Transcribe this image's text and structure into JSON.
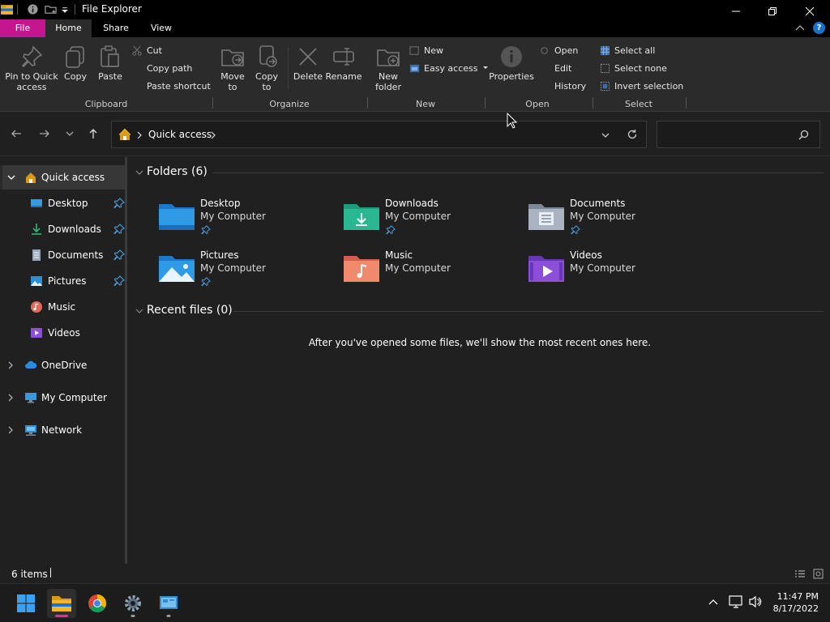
{
  "window": {
    "title": "File Explorer"
  },
  "ribbon_tabs": {
    "file": "File",
    "home": "Home",
    "share": "Share",
    "view": "View"
  },
  "ribbon": {
    "pin_quick_access": "Pin to Quick\naccess",
    "copy": "Copy",
    "paste": "Paste",
    "cut": "Cut",
    "copy_path": "Copy path",
    "paste_shortcut": "Paste shortcut",
    "move_to": "Move\nto",
    "copy_to": "Copy\nto",
    "delete": "Delete",
    "rename": "Rename",
    "new_folder": "New\nfolder",
    "new_item": "New",
    "easy_access": "Easy access",
    "properties": "Properties",
    "open": "Open",
    "edit": "Edit",
    "history": "History",
    "select_all": "Select all",
    "select_none": "Select none",
    "invert_selection": "Invert selection",
    "groups": {
      "clipboard": "Clipboard",
      "organize": "Organize",
      "new": "New",
      "open": "Open",
      "select": "Select"
    }
  },
  "address": {
    "location": "Quick access",
    "search_placeholder": ""
  },
  "nav": {
    "quick_access": "Quick access",
    "items": [
      {
        "label": "Desktop",
        "pinned": true
      },
      {
        "label": "Downloads",
        "pinned": true
      },
      {
        "label": "Documents",
        "pinned": true
      },
      {
        "label": "Pictures",
        "pinned": true
      },
      {
        "label": "Music",
        "pinned": false
      },
      {
        "label": "Videos",
        "pinned": false
      }
    ],
    "onedrive": "OneDrive",
    "my_computer": "My Computer",
    "network": "Network"
  },
  "content": {
    "folders_header": "Folders (6)",
    "recent_header": "Recent files (0)",
    "empty_message": "After you've opened some files, we'll show the most recent ones here.",
    "folders": [
      {
        "name": "Desktop",
        "location": "My Computer",
        "pinned": true
      },
      {
        "name": "Downloads",
        "location": "My Computer",
        "pinned": true
      },
      {
        "name": "Documents",
        "location": "My Computer",
        "pinned": true
      },
      {
        "name": "Pictures",
        "location": "My Computer",
        "pinned": true
      },
      {
        "name": "Music",
        "location": "My Computer",
        "pinned": false
      },
      {
        "name": "Videos",
        "location": "My Computer",
        "pinned": false
      }
    ]
  },
  "status": {
    "item_count": "6 items"
  },
  "taskbar": {
    "time": "11:47 PM",
    "date": "8/17/2022"
  },
  "colors": {
    "accent_file_tab": "#c5158f",
    "help_blue": "#1a73c7",
    "folder_blue": "#2f9be6",
    "pin_blue": "#4a9fe0"
  }
}
